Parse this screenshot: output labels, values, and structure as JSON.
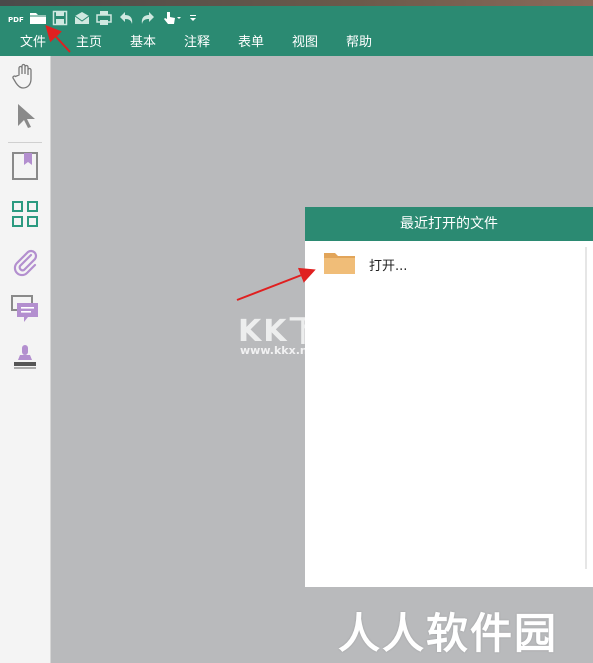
{
  "app": {
    "logo_text": "PDF",
    "brand_color": "#2b8a72"
  },
  "quick_access": [
    {
      "name": "open-folder-icon"
    },
    {
      "name": "save-icon"
    },
    {
      "name": "email-icon"
    },
    {
      "name": "print-icon"
    },
    {
      "name": "undo-icon"
    },
    {
      "name": "redo-icon"
    },
    {
      "name": "hand-touch-icon"
    },
    {
      "name": "customize-dropdown-icon"
    }
  ],
  "menu": {
    "items": [
      "文件",
      "主页",
      "基本",
      "注释",
      "表单",
      "视图",
      "帮助"
    ]
  },
  "sidebar": {
    "tools": [
      {
        "name": "hand-tool-icon"
      },
      {
        "name": "select-tool-icon"
      },
      {
        "name": "bookmark-icon"
      },
      {
        "name": "thumbnails-icon"
      },
      {
        "name": "attachment-icon"
      },
      {
        "name": "comments-icon"
      },
      {
        "name": "stamp-icon"
      }
    ]
  },
  "recent_panel": {
    "title": "最近打开的文件",
    "open_label": "打开..."
  },
  "watermarks": {
    "kkx": "KK下载",
    "kkx_url": "www.kkx.net",
    "site": "人人软件园"
  }
}
